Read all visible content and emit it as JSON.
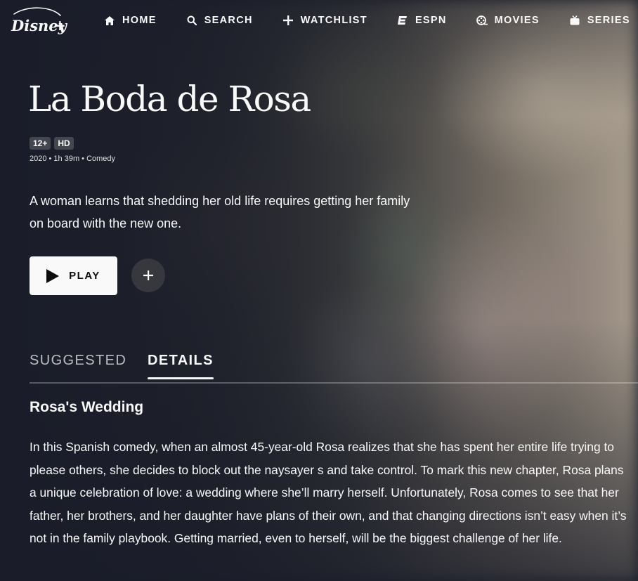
{
  "nav": {
    "logo_alt": "Disney+",
    "items": [
      {
        "label": "HOME",
        "icon": "home-icon"
      },
      {
        "label": "SEARCH",
        "icon": "search-icon"
      },
      {
        "label": "WATCHLIST",
        "icon": "plus-icon"
      },
      {
        "label": "ESPN",
        "icon": "espn-icon"
      },
      {
        "label": "MOVIES",
        "icon": "film-reel-icon"
      },
      {
        "label": "SERIES",
        "icon": "tv-icon"
      }
    ],
    "overflow_icon": "star-icon"
  },
  "title": {
    "text": "La Boda de Rosa",
    "rating": "12+",
    "quality": "HD",
    "meta": "2020 • 1h 39m • Comedy",
    "tagline": "A woman learns that shedding her old life requires getting her family on board with the new one."
  },
  "actions": {
    "play_label": "PLAY",
    "play_icon": "play-icon",
    "add_icon": "plus-icon"
  },
  "tabs": [
    {
      "label": "SUGGESTED",
      "active": false
    },
    {
      "label": "DETAILS",
      "active": true
    }
  ],
  "details": {
    "title": "Rosa's Wedding",
    "description": "In this Spanish comedy, when an almost 45-year-old Rosa realizes that she has spent her entire life trying to please others, she decides to block out the naysayer s and take control. To mark this new chapter, Rosa plans a unique celebration of love: a wedding where she’ll marry herself. Unfortunately, Rosa comes to see that her father, her brothers, and her daughter have plans of their own, and that changing directions isn’t easy when it’s not in the family playbook. Getting married, even to herself, will be the biggest challenge of her life."
  },
  "colors": {
    "background": "#1a1d29",
    "text": "#f9f9f9",
    "play_button_bg": "#f9f9f9"
  }
}
